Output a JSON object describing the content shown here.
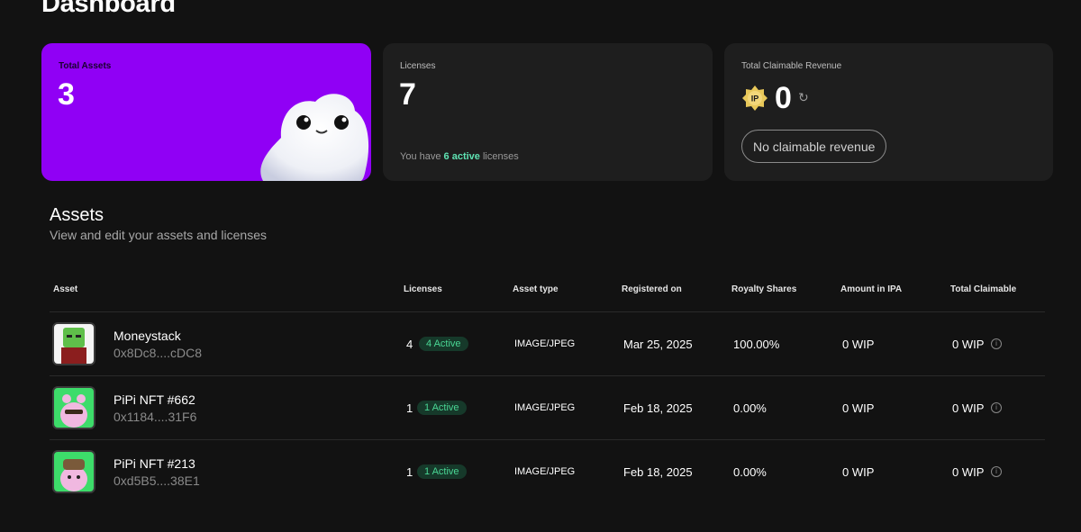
{
  "page": {
    "title": "Dashboard"
  },
  "cards": {
    "assets": {
      "label": "Total Assets",
      "value": "3"
    },
    "licenses": {
      "label": "Licenses",
      "value": "7",
      "note_prefix": "You have",
      "note_active": "6 active",
      "note_suffix": "licenses"
    },
    "revenue": {
      "label": "Total Claimable Revenue",
      "token": "IP",
      "value": "0",
      "button": "No claimable revenue"
    }
  },
  "assets_section": {
    "title": "Assets",
    "subtitle": "View and edit your assets and licenses"
  },
  "table": {
    "headers": [
      "Asset",
      "Licenses",
      "Asset type",
      "Registered on",
      "Royalty Shares",
      "Amount in IPA",
      "Total Claimable"
    ],
    "rows": [
      {
        "name": "Moneystack",
        "address": "0x8Dc8....cDC8",
        "licenses": "4",
        "active": "4 Active",
        "type": "IMAGE/JPEG",
        "registered": "Mar 25, 2025",
        "royalty": "100.00%",
        "amount": "0 WIP",
        "claimable": "0 WIP"
      },
      {
        "name": "PiPi NFT #662",
        "address": "0x1184....31F6",
        "licenses": "1",
        "active": "1 Active",
        "type": "IMAGE/JPEG",
        "registered": "Feb 18, 2025",
        "royalty": "0.00%",
        "amount": "0 WIP",
        "claimable": "0 WIP"
      },
      {
        "name": "PiPi NFT #213",
        "address": "0xd5B5....38E1",
        "licenses": "1",
        "active": "1 Active",
        "type": "IMAGE/JPEG",
        "registered": "Feb 18, 2025",
        "royalty": "0.00%",
        "amount": "0 WIP",
        "claimable": "0 WIP"
      }
    ]
  },
  "icons": {
    "refresh": "refresh-icon",
    "info": "info-icon",
    "coin": "ip-coin-icon"
  },
  "colors": {
    "accent": "#9000f5",
    "active_text": "#4ad795",
    "card_bg": "#1e1e1e"
  }
}
